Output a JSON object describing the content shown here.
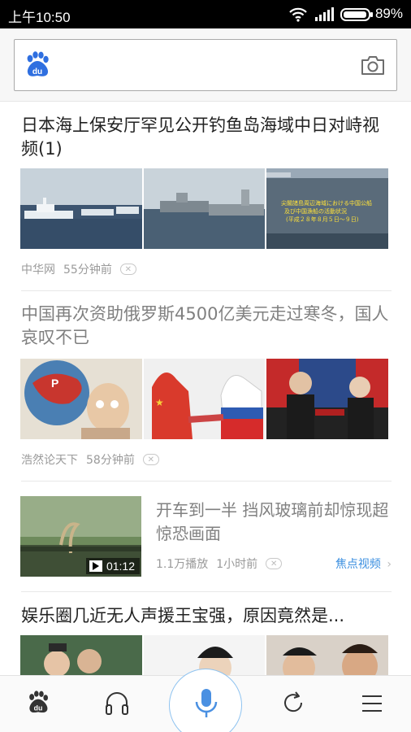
{
  "status_bar": {
    "time": "上午10:50",
    "battery_percent": "89%",
    "icons": [
      "wifi-icon",
      "signal-icon",
      "battery-icon"
    ]
  },
  "search": {
    "logo_icon": "baidu-paw-icon",
    "logo_text": "du",
    "camera_icon": "camera-icon",
    "placeholder": ""
  },
  "feed": {
    "items": [
      {
        "title": "日本海上保安厅罕见公开钓鱼岛海域中日对峙视频(1)",
        "source": "中华网",
        "time": "55分钟前",
        "thumb3_caption": "尖閣諸島周辺海域における中国公船\n及び中国漁船の活動状況\n(平成２８年８月５日～９日)"
      },
      {
        "title": "中国再次资助俄罗斯4500亿美元走过寒冬，国人哀叹不已",
        "source": "浩然论天下",
        "time": "58分钟前"
      },
      {
        "title": "开车到一半 挡风玻璃前却惊现超惊恐画面",
        "duration": "01:12",
        "plays": "1.1万播放",
        "time": "1小时前",
        "source": "焦点视频"
      },
      {
        "title": "娱乐圈几近无人声援王宝强，原因竟然是..."
      }
    ]
  },
  "bottom_nav": {
    "items": [
      "home-paw-icon",
      "headphones-icon",
      "mic-icon",
      "refresh-icon",
      "menu-icon"
    ]
  },
  "colors": {
    "accent": "#3b8fe0",
    "brand_blue": "#2f6fe0",
    "mic_blue": "#4a90e2"
  }
}
